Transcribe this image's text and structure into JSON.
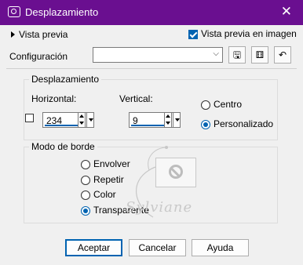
{
  "window": {
    "title": "Desplazamiento",
    "close_glyph": "✕"
  },
  "preview": {
    "toggle_label": "Vista previa",
    "checkbox_label": "Vista previa en imagen",
    "checked": true
  },
  "config": {
    "label": "Configuración",
    "value": ""
  },
  "offset_group": {
    "title": "Desplazamiento",
    "horizontal_label": "Horizontal:",
    "horizontal_value": "234",
    "vertical_label": "Vertical:",
    "vertical_value": "9",
    "radio_center": "Centro",
    "radio_custom": "Personalizado",
    "selected": "Personalizado"
  },
  "border_group": {
    "title": "Modo de borde",
    "options": [
      "Envolver",
      "Repetir",
      "Color",
      "Transparente"
    ],
    "selected": "Transparente"
  },
  "watermark": "Sylviane",
  "buttons": {
    "ok": "Aceptar",
    "cancel": "Cancelar",
    "help": "Ayuda"
  },
  "colors": {
    "titlebar": "#6a0f90",
    "accent": "#0063b1"
  }
}
